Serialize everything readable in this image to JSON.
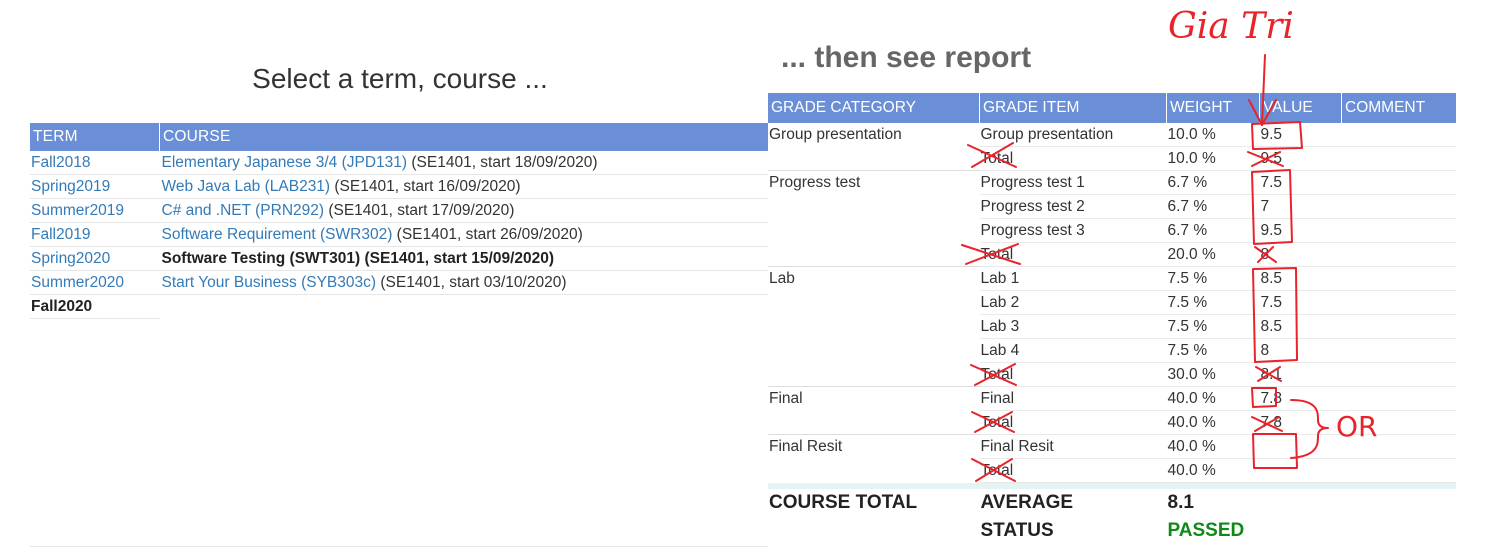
{
  "left": {
    "title": "Select a term, course ...",
    "headers": {
      "term": "TERM",
      "course": "COURSE"
    },
    "rows": [
      {
        "term": "Fall2018",
        "course_link": "Elementary Japanese 3/4 (JPD131)",
        "course_info": " (SE1401, start 18/09/2020)"
      },
      {
        "term": "Spring2019",
        "course_link": "Web Java Lab (LAB231)",
        "course_info": " (SE1401, start 16/09/2020)"
      },
      {
        "term": "Summer2019",
        "course_link": "C# and .NET (PRN292)",
        "course_info": " (SE1401, start 17/09/2020)"
      },
      {
        "term": "Fall2019",
        "course_link": "Software Requirement (SWR302)",
        "course_info": " (SE1401, start 26/09/2020)"
      },
      {
        "term": "Spring2020",
        "course_selected": "Software Testing (SWT301) (SE1401, start 15/09/2020)"
      },
      {
        "term": "Summer2020",
        "course_link": "Start Your Business (SYB303c)",
        "course_info": " (SE1401, start 03/10/2020)"
      },
      {
        "term_selected": "Fall2020"
      }
    ]
  },
  "right": {
    "title": "... then see report",
    "headers": {
      "category": "GRADE CATEGORY",
      "item": "GRADE ITEM",
      "weight": "WEIGHT",
      "value": "VALUE",
      "comment": "COMMENT"
    },
    "rows": [
      {
        "category": "Group presentation",
        "item": "Group presentation",
        "weight": "10.0 %",
        "value": "9.5"
      },
      {
        "category": "",
        "item": "Total",
        "weight": "10.0 %",
        "value": "9.5"
      },
      {
        "category": "Progress test",
        "item": "Progress test 1",
        "weight": "6.7 %",
        "value": "7.5"
      },
      {
        "category": "",
        "item": "Progress test 2",
        "weight": "6.7 %",
        "value": "7"
      },
      {
        "category": "",
        "item": "Progress test 3",
        "weight": "6.7 %",
        "value": "9.5"
      },
      {
        "category": "",
        "item": "Total",
        "weight": "20.0 %",
        "value": "8"
      },
      {
        "category": "Lab",
        "item": "Lab 1",
        "weight": "7.5 %",
        "value": "8.5"
      },
      {
        "category": "",
        "item": "Lab 2",
        "weight": "7.5 %",
        "value": "7.5"
      },
      {
        "category": "",
        "item": "Lab 3",
        "weight": "7.5 %",
        "value": "8.5"
      },
      {
        "category": "",
        "item": "Lab 4",
        "weight": "7.5 %",
        "value": "8"
      },
      {
        "category": "",
        "item": "Total",
        "weight": "30.0 %",
        "value": "8.1"
      },
      {
        "category": "Final",
        "item": "Final",
        "weight": "40.0 %",
        "value": "7.8"
      },
      {
        "category": "",
        "item": "Total",
        "weight": "40.0 %",
        "value": "7.8"
      },
      {
        "category": "Final Resit",
        "item": "Final Resit",
        "weight": "40.0 %",
        "value": ""
      },
      {
        "category": "",
        "item": "Total",
        "weight": "40.0 %",
        "value": ""
      }
    ],
    "course_total": {
      "label": "COURSE TOTAL",
      "average_label": "AVERAGE",
      "average_value": "8.1",
      "status_label": "STATUS",
      "status_value": "PASSED"
    }
  },
  "annotations": {
    "gia_tri": "Gia Tri",
    "or": "OR"
  },
  "colors": {
    "header_bg": "#6b8fd6",
    "link": "#337ab7",
    "passed": "#0f8a1a",
    "annotation": "#e8232b"
  }
}
